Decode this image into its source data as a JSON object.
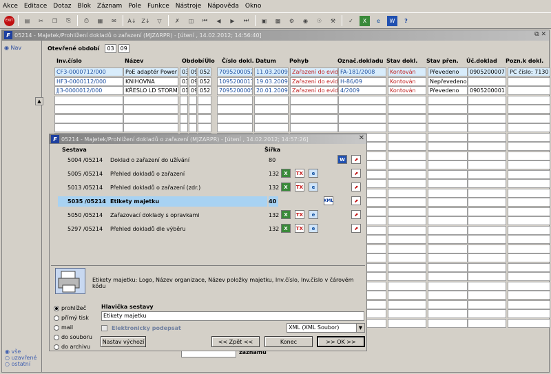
{
  "menu": [
    "Akce",
    "Editace",
    "Dotaz",
    "Blok",
    "Záznam",
    "Pole",
    "Funkce",
    "Nástroje",
    "Nápověda",
    "Okno"
  ],
  "toolbar_icons": [
    "exit-icon",
    "save-icon",
    "print-icon",
    "sort-asc-icon",
    "sort-desc-icon",
    "filter-icon",
    "search-icon",
    "tools-icon",
    "help-icon"
  ],
  "window": {
    "title": "05214 - Majetek/Prohlížení dokladů o zařazení (MJZARPR) - [útení , 14.02.2012; 14:56:40]",
    "nav": "Nav",
    "period_label": "Otevřené období",
    "period_month": "03",
    "period_year": "09"
  },
  "grid": {
    "headers": [
      "Inv.číslo",
      "Název",
      "Období",
      "Úlo",
      "Číslo dokl.",
      "Datum",
      "Pohyb",
      "Označ.dokladu",
      "Stav dokl.",
      "Stav přen.",
      "Úč.doklad",
      "Pozn.k dokl."
    ],
    "rows": [
      [
        "CF3-0000712/000",
        "PoE adaptér Power",
        "03",
        "09",
        "052",
        "7095200052",
        "11.03.2009",
        "Zařazení do evide",
        "FA-181/2008",
        "Kontován",
        "Převedeno",
        "0905200007",
        "PC číslo: 7130"
      ],
      [
        "HF3-0000112/000",
        "KNIHOVNA",
        "03",
        "09",
        "052",
        "1095200011",
        "19.03.2009",
        "Zařazení do evide",
        "H-86/09",
        "Kontován",
        "Nepřevedeno",
        "",
        ""
      ],
      [
        "JJ3-0000012/000",
        "KŘESLO LD STORM",
        "01",
        "09",
        "052",
        "7095200005",
        "20.01.2009",
        "Zařazení do evide",
        "4/2009",
        "Kontován",
        "Převedeno",
        "0905200001",
        ""
      ]
    ],
    "records_label": "záznamů",
    "filters": [
      "vše",
      "uzavřené",
      "ostatní"
    ]
  },
  "dialog": {
    "title": "05214 - Majetek/Prohlížení dokladů o zařazení (MJZARPR) - [útení , 14.02.2012; 14:57:26]",
    "col_sestava": "Sestava",
    "col_sirka": "Šířka",
    "reports": [
      {
        "code": "5004 /05214",
        "name": "Doklad o zařazení do užívání",
        "width": "80"
      },
      {
        "code": "5005 /05214",
        "name": "Přehled dokladů o zařazení",
        "width": "132"
      },
      {
        "code": "5013 /05214",
        "name": "Přehled dokladů o zařazení (zdr.)",
        "width": "132"
      },
      {
        "code": "5035 /05214",
        "name": "Etikety majetku",
        "width": "40"
      },
      {
        "code": "5050 /05214",
        "name": "Zařazovací doklady s opravkami",
        "width": "132"
      },
      {
        "code": "5297 /05214",
        "name": "Přehled dokladů dle výběru",
        "width": "132"
      }
    ],
    "description": "Etikety majetku: Logo, Název organizace, Název položky majetku, Inv.číslo, Inv.číslo v čárovém kódu",
    "output_options": [
      "prohlížeč",
      "přímý tisk",
      "mail",
      "do souboru",
      "do archivu"
    ],
    "header_label": "Hlavička sestavy",
    "header_value": "Etikety majetku",
    "electronic_sign": "Elektronicky podepsat",
    "format": "XML (XML Soubor)",
    "buttons": {
      "defaults": "Nastav výchozí",
      "back": "<< Zpět <<",
      "end": "Konec",
      "ok": ">> OK >>"
    }
  }
}
